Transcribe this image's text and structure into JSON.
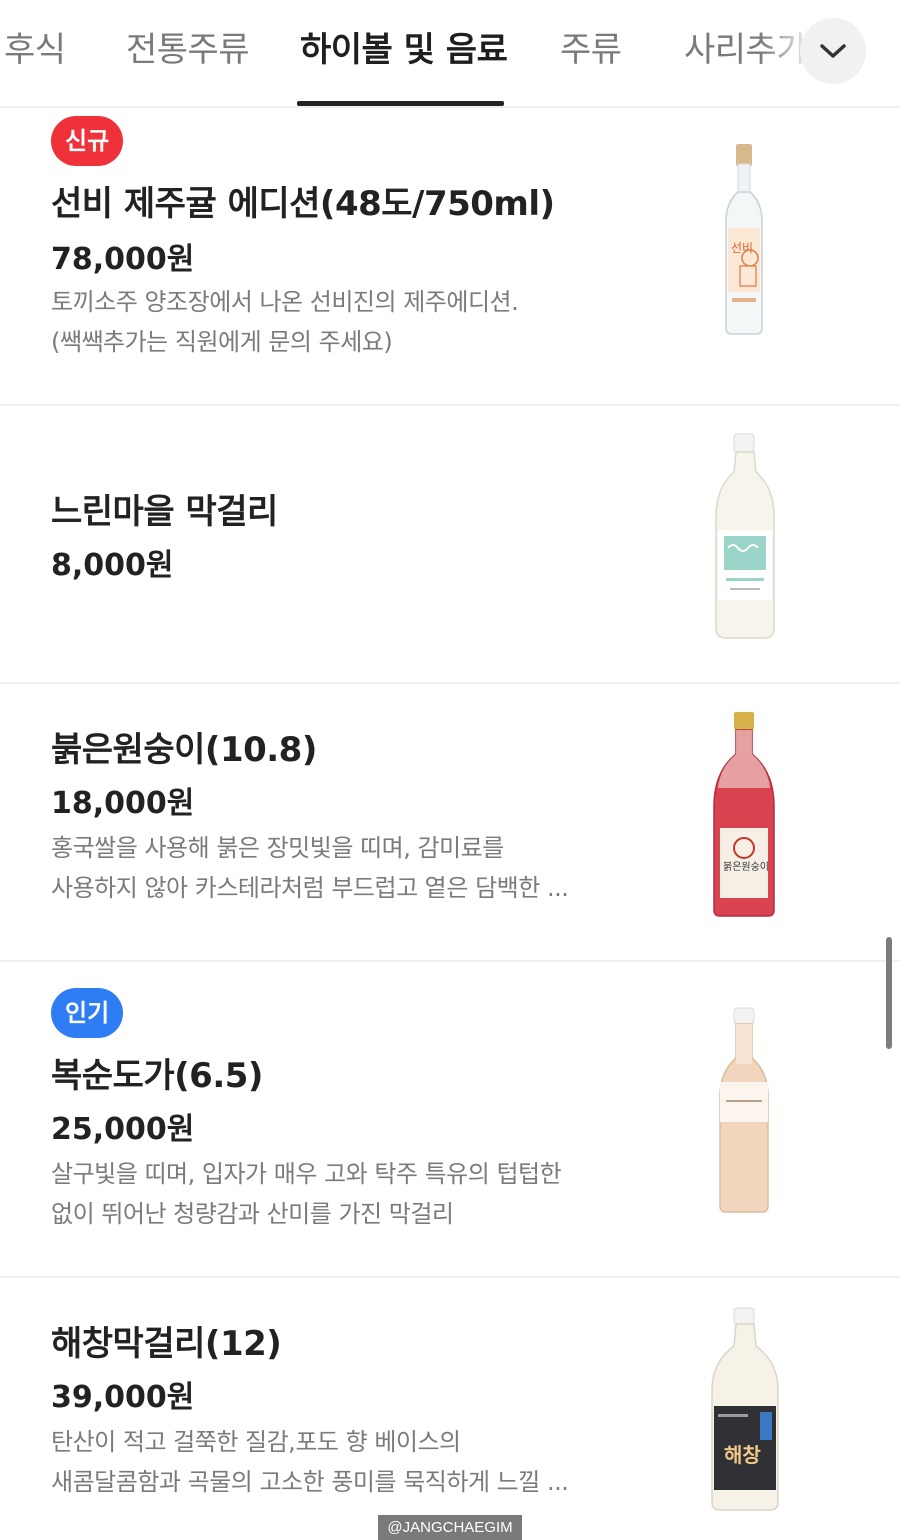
{
  "tabs": {
    "items": [
      {
        "label": "후식"
      },
      {
        "label": "전통주류"
      },
      {
        "label": "하이볼 및 음료"
      },
      {
        "label": "주류"
      },
      {
        "label": "사리추가"
      }
    ],
    "active_index": 2,
    "more_icon": "chevron-down-icon"
  },
  "menu": [
    {
      "badge": "신규",
      "badge_type": "new",
      "name": "선비 제주귤 에디션(48도/750ml)",
      "price": "78,000원",
      "desc_lines": [
        "토끼소주 양조장에서 나온 선비진의 제주에디션.",
        "(쌕쌕추가는 직원에게 문의 주세요)"
      ],
      "image_icon": "clear-liquor-bottle-icon",
      "bottle_label": "선비"
    },
    {
      "badge": "",
      "name": "느린마을 막걸리",
      "price": "8,000원",
      "desc_lines": [],
      "image_icon": "makgeolli-bottle-icon"
    },
    {
      "badge": "",
      "name": "붉은원숭이(10.8)",
      "price": "18,000원",
      "desc_lines": [
        "홍국쌀을 사용해 붉은 장밋빛을 띠며, 감미료를",
        "사용하지 않아 카스테라처럼 부드럽고 옅은 담백한 ..."
      ],
      "image_icon": "red-wine-bottle-icon",
      "bottle_label": "붉은원숭이"
    },
    {
      "badge": "인기",
      "badge_type": "hot",
      "name": "복순도가(6.5)",
      "price": "25,000원",
      "desc_lines": [
        "살구빛을 띠며, 입자가 매우 고와 탁주 특유의 텁텁한",
        "없이 뛰어난 청량감과 산미를 가진 막걸리"
      ],
      "image_icon": "peach-makgeolli-bottle-icon"
    },
    {
      "badge": "",
      "name": "해창막걸리(12)",
      "price": "39,000원",
      "desc_lines": [
        "탄산이 적고 걸쭉한 질감,포도 향 베이스의",
        "새콤달콤함과 곡물의 고소한 풍미를 묵직하게 느낄 ..."
      ],
      "image_icon": "black-label-makgeolli-bottle-icon",
      "bottle_label": "해창"
    }
  ],
  "watermark": "@JANGCHAEGIM",
  "colors": {
    "badge_new": "#ef3139",
    "badge_hot": "#2f7df5",
    "text_primary": "#222222",
    "text_secondary": "#7b7b7b"
  }
}
